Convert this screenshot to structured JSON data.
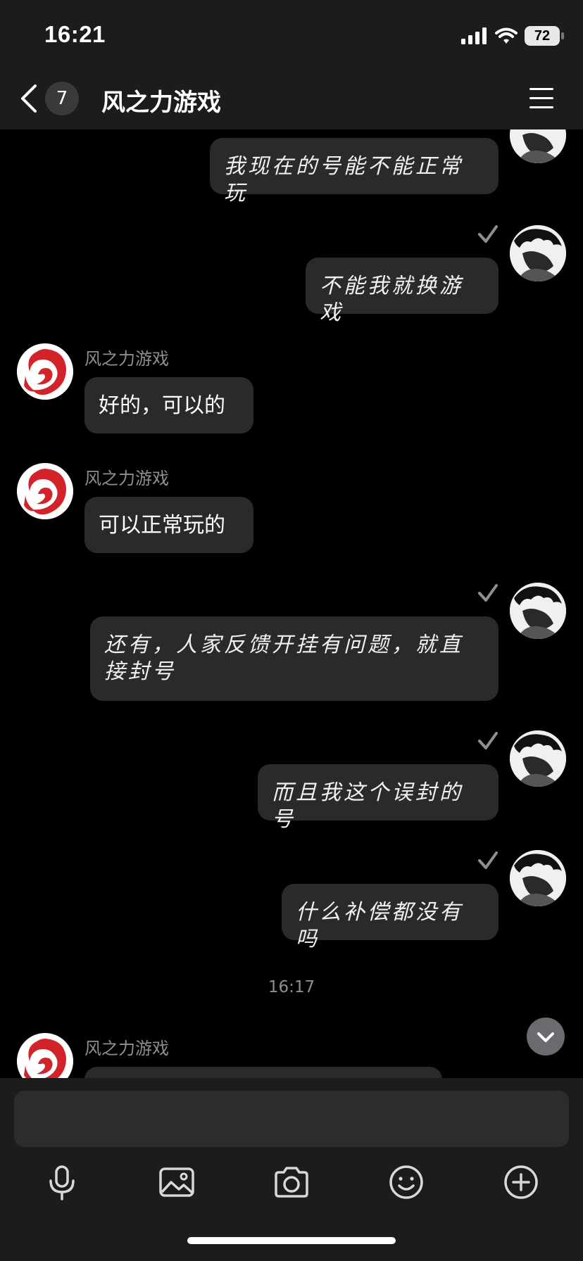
{
  "status_bar": {
    "time": "16:21",
    "battery": "72"
  },
  "nav": {
    "unread_count": "7",
    "title": "风之力游戏"
  },
  "messages": [
    {
      "text": "我现在的号能不能正常玩"
    },
    {
      "text": "不能我就换游戏"
    },
    {
      "sender": "风之力游戏",
      "text": "好的，可以的"
    },
    {
      "sender": "风之力游戏",
      "text": "可以正常玩的"
    },
    {
      "text": "还有，人家反馈开挂有问题，就直接封号"
    },
    {
      "text": "而且我这个误封的号"
    },
    {
      "text": "什么补偿都没有吗"
    },
    {
      "sender": "风之力游戏",
      "text": ""
    }
  ],
  "timestamp": "16:17",
  "composer": {
    "placeholder": ""
  },
  "toolbar": [
    "microphone-icon",
    "image-icon",
    "camera-icon",
    "emoji-icon",
    "plus-icon"
  ],
  "colors": {
    "background": "#000000",
    "bar": "#1c1c1e",
    "bubble": "#2a2a2d",
    "muted_text": "#8e8e93",
    "brand_red": "#d2232a"
  }
}
